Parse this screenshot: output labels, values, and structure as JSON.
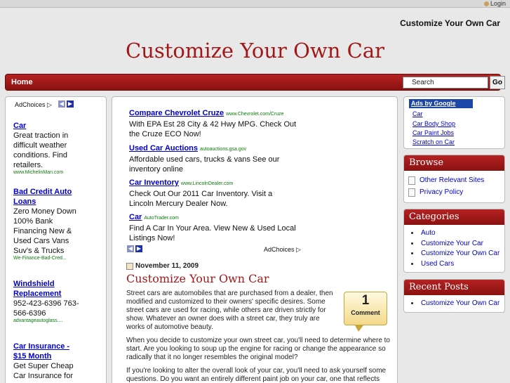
{
  "topbar": {
    "login_label": "Login"
  },
  "header": {
    "tagline": "Customize Your Own Car",
    "site_title": "Customize Your Own Car"
  },
  "nav": {
    "home_label": "Home",
    "search_value": "Search",
    "go_label": "Go"
  },
  "left_ads": {
    "adchoices_label": "AdChoices",
    "items": [
      {
        "title": "Car",
        "desc": "Great traction in difficult weather conditions. Find retailers.",
        "url": "www.MichelinMan.com"
      },
      {
        "title": "Bad Credit Auto Loans",
        "desc": "Zero Money Down 100% Bank Financing New & Used Cars Vans Suv's & Trucks",
        "url": "We-Finance-Bad-Cred..."
      },
      {
        "title": "Windshield Replacement",
        "desc": "952-423-6396 763-566-6396",
        "url": "advantageautoglass...."
      },
      {
        "title": "Car Insurance - $15 Month",
        "desc": "Get Super Cheap Car Insurance for",
        "url": ""
      }
    ]
  },
  "main_ads": {
    "adchoices_label": "AdChoices",
    "items": [
      {
        "title": "Compare Chevrolet Cruze",
        "url": "www.Chevrolet.com/Cruze",
        "desc": "With EPA Est 28 City & 42 Hwy MPG. Check Out the Cruze ECO Now!"
      },
      {
        "title": "Used Car Auctions",
        "url": "autoauctions.gsa.gov",
        "desc": "Affordable used cars, trucks & vans See our inventory online"
      },
      {
        "title": "Car Inventory",
        "url": "www.LincolnDealer.com",
        "desc": "Check Out Our 2011 Car Inventory. Visit a Lincoln Mercury Dealer Now."
      },
      {
        "title": "Car",
        "url": "AutoTrader.com",
        "desc": "Find A Car In Your Area. View New & Used Local Listings Now!"
      }
    ]
  },
  "post": {
    "date": "November 11, 2009",
    "title": "Customize Your Own Car",
    "comment_count": "1",
    "comment_label": "Comment",
    "paragraphs": [
      "Street cars are automobiles that are purchased from a dealer, then modified and customized to their owners' specific desires. Some street cars are used for racing, while others are driven strictly for show. Whatever an owner does with a street car, they truly are works of automotive beauty.",
      "When you decide to customize your own street car, you'll need to determine where to start. Are you looking to soup up the engine for racing or change the appearance so radically that it no longer resembles the original model?",
      "If you're looking to alter the overall look of your car, you'll need to ask yourself some questions. Do you want an entirely different paint job on your car, one that reflects"
    ]
  },
  "sidebar": {
    "google_ads": {
      "label": "Ads by Google",
      "links": [
        "Car",
        "Car Body Shop",
        "Car Paint Jobs",
        "Scratch on Car"
      ]
    },
    "browse": {
      "title": "Browse",
      "links": [
        "Other Relevant Sites",
        "Privacy Policy"
      ]
    },
    "categories": {
      "title": "Categories",
      "links": [
        "Auto",
        "Customize Your Car",
        "Customize Your Own Car",
        "Used Cars"
      ]
    },
    "recent": {
      "title": "Recent Posts",
      "links": [
        "Customize Your Own Car"
      ]
    }
  }
}
